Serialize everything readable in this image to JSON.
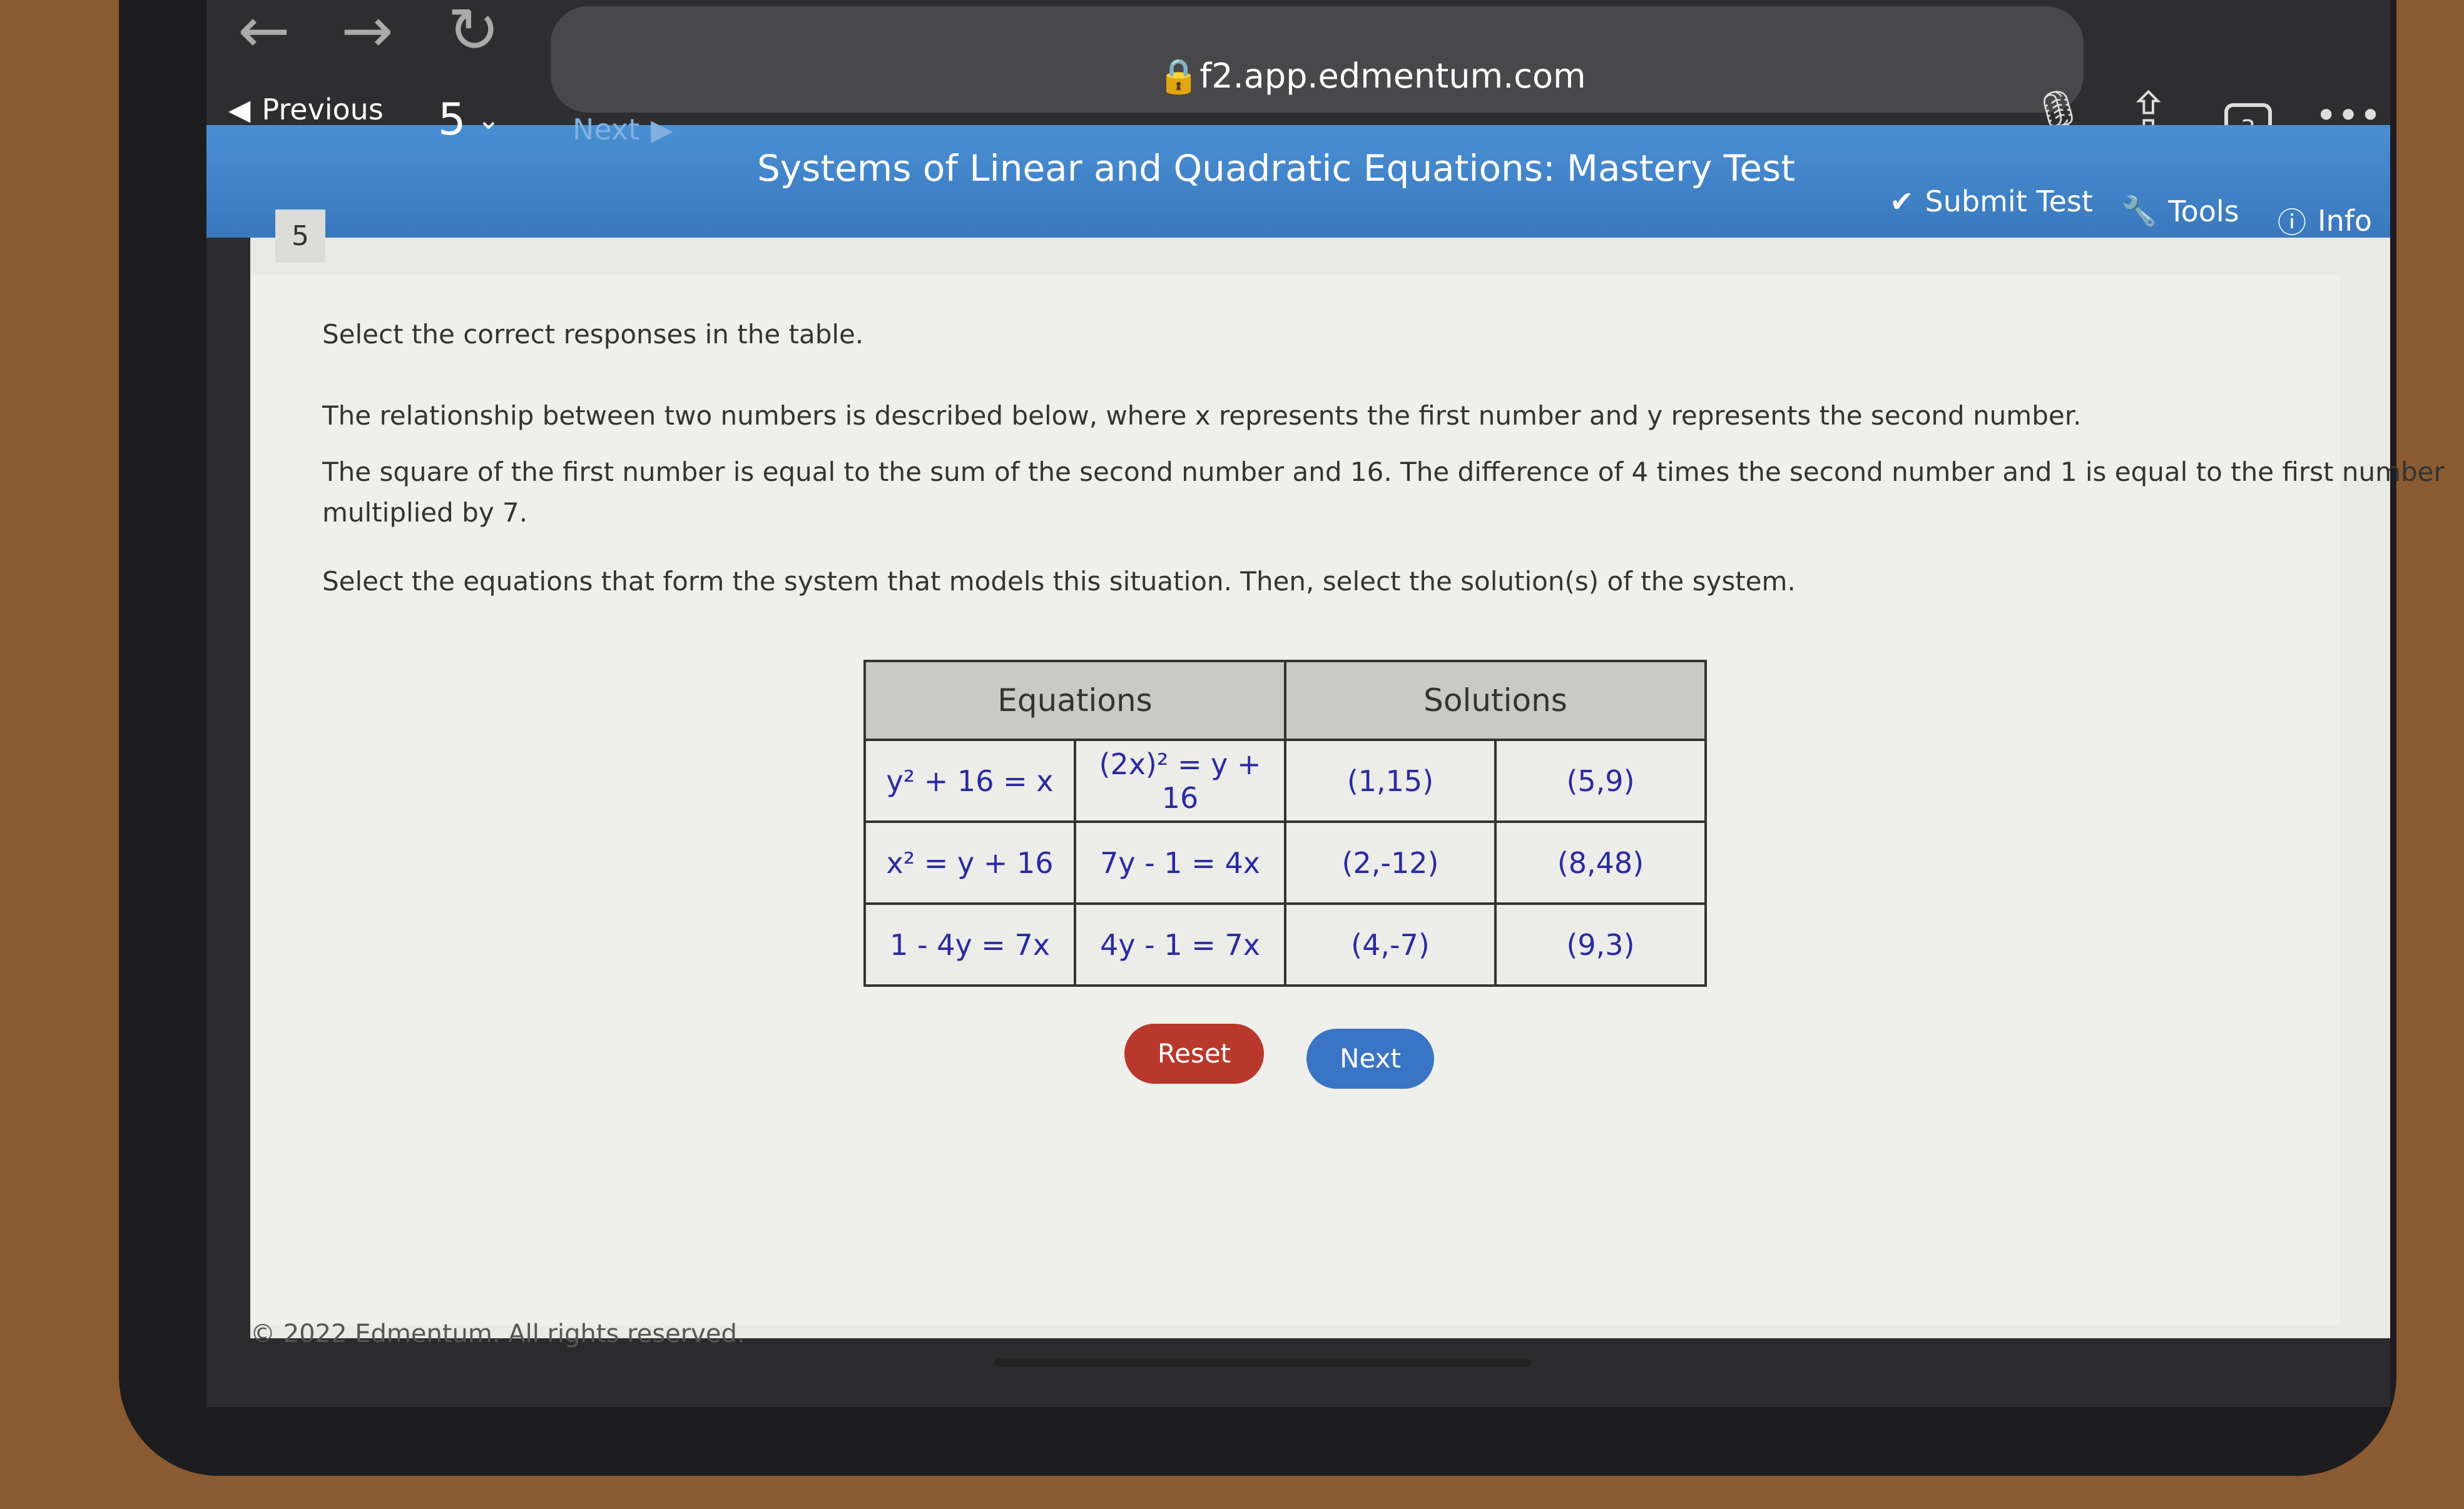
{
  "browser": {
    "url": "f2.app.edmentum.com",
    "tab_count": "3"
  },
  "header": {
    "previous_label": "Previous",
    "question_selector": "5",
    "next_label": "Next",
    "title": "Systems of Linear and Quadratic Equations: Mastery Test",
    "submit_label": "Submit Test",
    "tools_label": "Tools",
    "info_label": "Info",
    "color": "#3f82c6"
  },
  "question": {
    "number": "5",
    "instruction": "Select the correct responses in the table.",
    "paragraph1": "The relationship between two numbers is described below, where x represents the first number and y represents the second number.",
    "paragraph2a": "The square of the first number is equal to the sum of the second number and 16. The difference of 4 times the second number and 1 is equal to the first number",
    "paragraph2b": "multiplied by 7.",
    "paragraph3": "Select the equations that form the system that models this situation. Then, select the solution(s) of the system."
  },
  "table": {
    "headers": [
      "Equations",
      "Solutions"
    ],
    "rows": [
      [
        "y² + 16 = x",
        "(2x)² = y + 16",
        "(1,15)",
        "(5,9)"
      ],
      [
        "x² = y + 16",
        "7y - 1 = 4x",
        "(2,-12)",
        "(8,48)"
      ],
      [
        "1 - 4y = 7x",
        "4y - 1 = 7x",
        "(4,-7)",
        "(9,3)"
      ]
    ]
  },
  "buttons": {
    "reset": "Reset",
    "next": "Next",
    "reset_color": "#b8392b",
    "next_color": "#3a74c4"
  },
  "footer": {
    "copyright": "© 2022 Edmentum. All rights reserved."
  }
}
